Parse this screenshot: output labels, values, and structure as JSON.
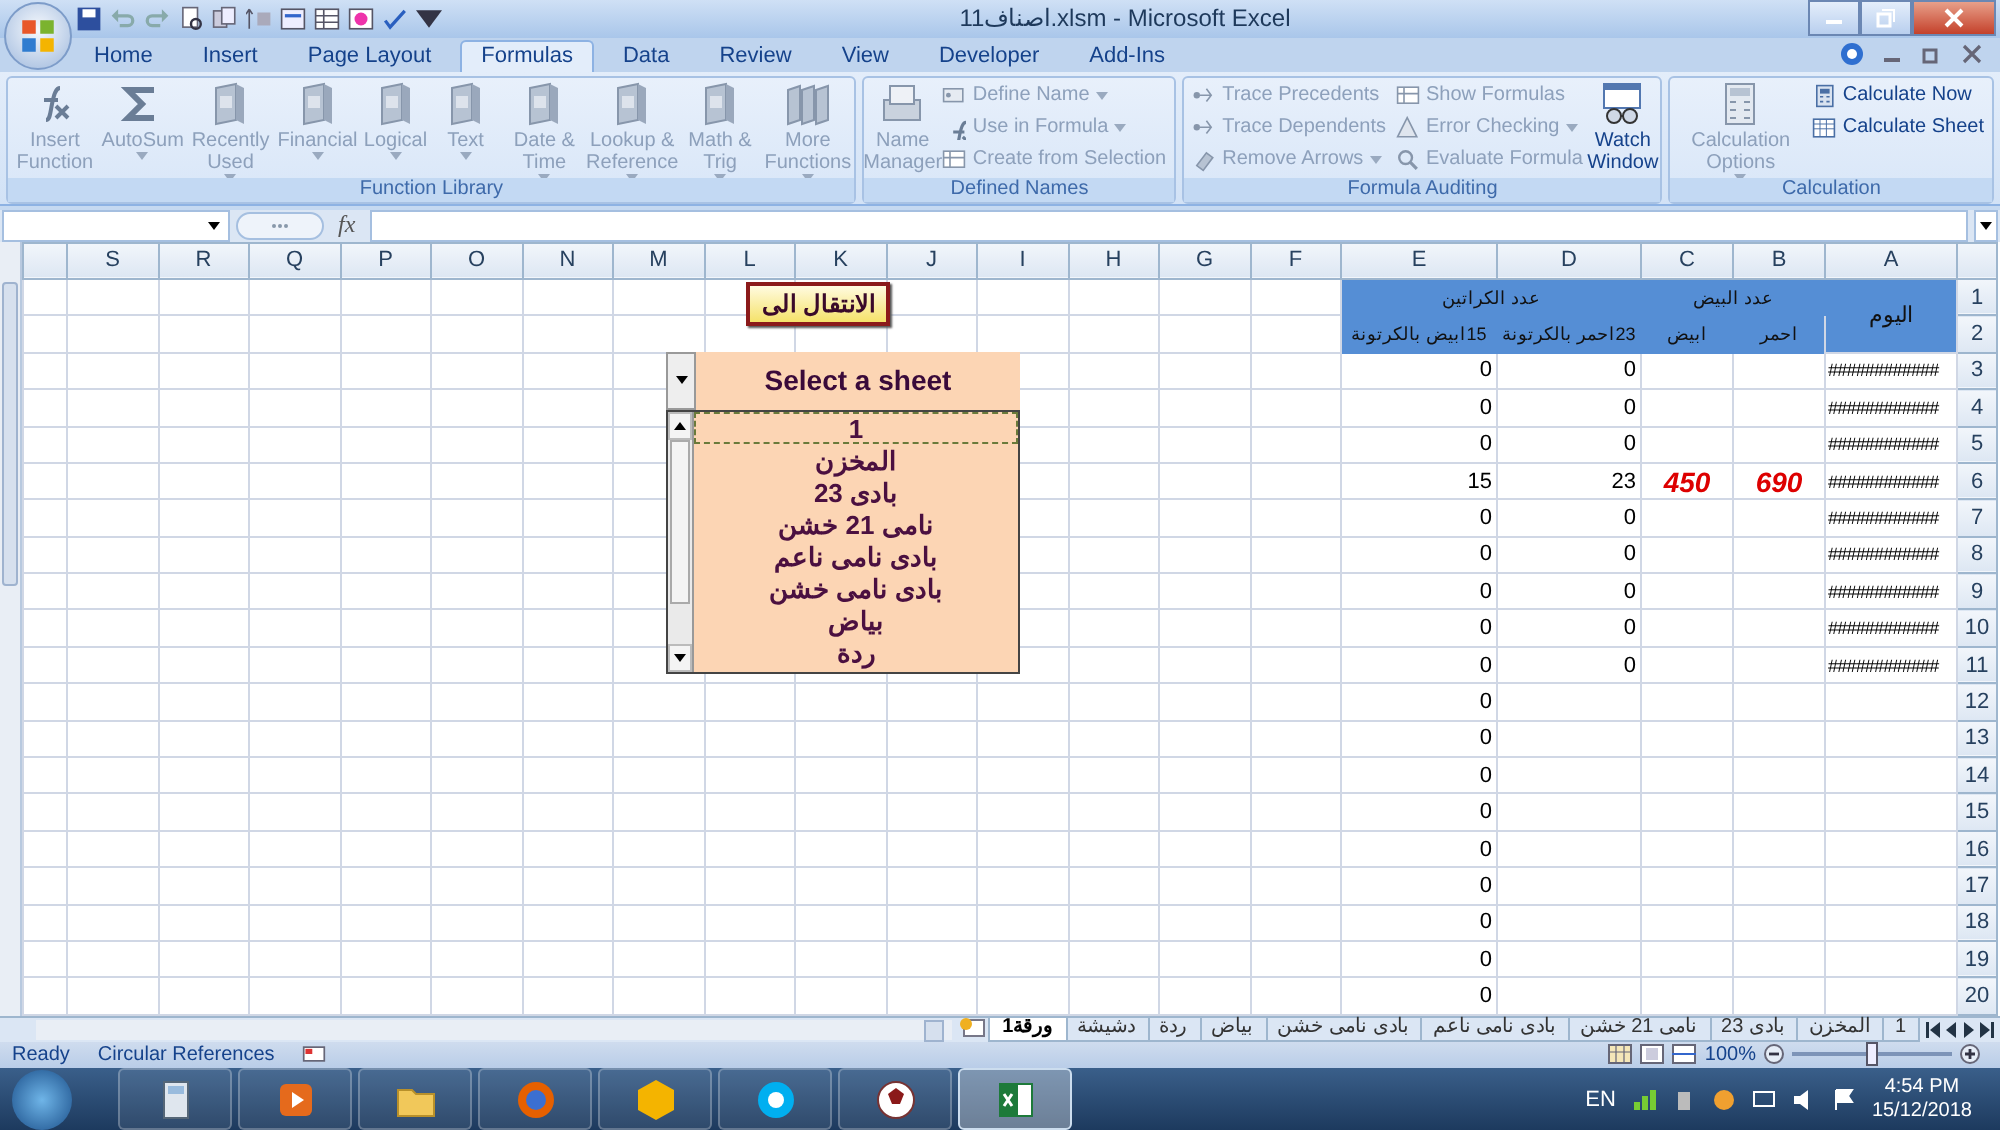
{
  "window": {
    "title": "اصناف11.xlsm - Microsoft Excel"
  },
  "tabs": [
    {
      "label": "Home",
      "selected": false
    },
    {
      "label": "Insert",
      "selected": false
    },
    {
      "label": "Page Layout",
      "selected": false
    },
    {
      "label": "Formulas",
      "selected": true
    },
    {
      "label": "Data",
      "selected": false
    },
    {
      "label": "Review",
      "selected": false
    },
    {
      "label": "View",
      "selected": false
    },
    {
      "label": "Developer",
      "selected": false
    },
    {
      "label": "Add-Ins",
      "selected": false
    }
  ],
  "ribbon": {
    "groups": [
      {
        "label": "Function Library",
        "items": [
          {
            "kind": "large",
            "label": "Insert Function",
            "disabled": true,
            "menu": false
          },
          {
            "kind": "large",
            "label": "AutoSum",
            "disabled": true,
            "menu": true
          },
          {
            "kind": "large",
            "label": "Recently Used",
            "disabled": true,
            "menu": true
          },
          {
            "kind": "large",
            "label": "Financial",
            "disabled": true,
            "menu": true
          },
          {
            "kind": "large",
            "label": "Logical",
            "disabled": true,
            "menu": true
          },
          {
            "kind": "large",
            "label": "Text",
            "disabled": true,
            "menu": true
          },
          {
            "kind": "large",
            "label": "Date & Time",
            "disabled": true,
            "menu": true
          },
          {
            "kind": "large",
            "label": "Lookup & Reference",
            "disabled": true,
            "menu": true
          },
          {
            "kind": "large",
            "label": "Math & Trig",
            "disabled": true,
            "menu": true
          },
          {
            "kind": "large",
            "label": "More Functions",
            "disabled": true,
            "menu": true
          }
        ]
      },
      {
        "label": "Defined Names",
        "items": [
          {
            "kind": "large",
            "label": "Name Manager",
            "disabled": true,
            "menu": false
          },
          {
            "kind": "small",
            "label": "Define Name",
            "disabled": true,
            "menu": true
          },
          {
            "kind": "small",
            "label": "Use in Formula",
            "disabled": true,
            "menu": true
          },
          {
            "kind": "small",
            "label": "Create from Selection",
            "disabled": true,
            "menu": false
          }
        ]
      },
      {
        "label": "Formula Auditing",
        "items": [
          {
            "kind": "small",
            "label": "Trace Precedents",
            "disabled": true,
            "menu": false
          },
          {
            "kind": "small",
            "label": "Trace Dependents",
            "disabled": true,
            "menu": false
          },
          {
            "kind": "small",
            "label": "Remove Arrows",
            "disabled": true,
            "menu": true
          },
          {
            "kind": "small",
            "label": "Show Formulas",
            "disabled": true,
            "menu": false
          },
          {
            "kind": "small",
            "label": "Error Checking",
            "disabled": true,
            "menu": true
          },
          {
            "kind": "small",
            "label": "Evaluate Formula",
            "disabled": true,
            "menu": false
          },
          {
            "kind": "large",
            "label": "Watch Window",
            "disabled": false,
            "menu": false
          }
        ]
      },
      {
        "label": "Calculation",
        "items": [
          {
            "kind": "large",
            "label": "Calculation Options",
            "disabled": true,
            "menu": true
          },
          {
            "kind": "small",
            "label": "Calculate Now",
            "disabled": false,
            "menu": false
          },
          {
            "kind": "small",
            "label": "Calculate Sheet",
            "disabled": false,
            "menu": false
          }
        ]
      }
    ]
  },
  "formula_bar": {
    "fx_label": "fx"
  },
  "sheet": {
    "columns": [
      "S",
      "R",
      "Q",
      "P",
      "O",
      "N",
      "M",
      "L",
      "K",
      "J",
      "I",
      "H",
      "G",
      "F",
      "E",
      "D",
      "C",
      "B",
      "A"
    ],
    "rows": [
      {
        "number": "1",
        "cells": {
          "E": {
            "text": "عدد الكراتين",
            "kind": "header_wide"
          },
          "C": {
            "text": "عدد البيض",
            "kind": "header_wide"
          },
          "A": {
            "text": "اليوم",
            "kind": "header_tall"
          }
        }
      },
      {
        "number": "2",
        "cells": {
          "B": {
            "text": "احمر",
            "kind": "header"
          },
          "C": {
            "text": "ابيض",
            "kind": "header"
          },
          "D": {
            "text": "23احمر بالكرتونة",
            "kind": "header"
          },
          "E": {
            "text": "15ابيض بالكرتونة",
            "kind": "header"
          }
        }
      },
      {
        "number": "3",
        "cells": {
          "A": {
            "text": "############",
            "kind": "text"
          },
          "D": {
            "text": "0",
            "kind": "number"
          },
          "E": {
            "text": "0",
            "kind": "number"
          }
        }
      },
      {
        "number": "4",
        "cells": {
          "A": {
            "text": "############",
            "kind": "text"
          },
          "D": {
            "text": "0",
            "kind": "number"
          },
          "E": {
            "text": "0",
            "kind": "number"
          }
        }
      },
      {
        "number": "5",
        "cells": {
          "A": {
            "text": "############",
            "kind": "text"
          },
          "D": {
            "text": "0",
            "kind": "number"
          },
          "E": {
            "text": "0",
            "kind": "number"
          }
        }
      },
      {
        "number": "6",
        "cells": {
          "A": {
            "text": "############",
            "kind": "text"
          },
          "B": {
            "text": "690",
            "kind": "highlight"
          },
          "C": {
            "text": "450",
            "kind": "highlight"
          },
          "D": {
            "text": "23",
            "kind": "number"
          },
          "E": {
            "text": "15",
            "kind": "number"
          }
        }
      },
      {
        "number": "7",
        "cells": {
          "A": {
            "text": "############",
            "kind": "text"
          },
          "D": {
            "text": "0",
            "kind": "number"
          },
          "E": {
            "text": "0",
            "kind": "number"
          }
        }
      },
      {
        "number": "8",
        "cells": {
          "A": {
            "text": "############",
            "kind": "text"
          },
          "D": {
            "text": "0",
            "kind": "number"
          },
          "E": {
            "text": "0",
            "kind": "number"
          }
        }
      },
      {
        "number": "9",
        "cells": {
          "A": {
            "text": "############",
            "kind": "text"
          },
          "D": {
            "text": "0",
            "kind": "number"
          },
          "E": {
            "text": "0",
            "kind": "number"
          }
        }
      },
      {
        "number": "10",
        "cells": {
          "A": {
            "text": "############",
            "kind": "text"
          },
          "D": {
            "text": "0",
            "kind": "number"
          },
          "E": {
            "text": "0",
            "kind": "number"
          }
        }
      },
      {
        "number": "11",
        "cells": {
          "A": {
            "text": "############",
            "kind": "text"
          },
          "D": {
            "text": "0",
            "kind": "number"
          },
          "E": {
            "text": "0",
            "kind": "number"
          }
        }
      },
      {
        "number": "12",
        "cells": {
          "E": {
            "text": "0",
            "kind": "number"
          }
        }
      },
      {
        "number": "13",
        "cells": {
          "E": {
            "text": "0",
            "kind": "number"
          }
        }
      },
      {
        "number": "14",
        "cells": {
          "E": {
            "text": "0",
            "kind": "number"
          }
        }
      },
      {
        "number": "15",
        "cells": {
          "E": {
            "text": "0",
            "kind": "number"
          }
        }
      },
      {
        "number": "16",
        "cells": {
          "E": {
            "text": "0",
            "kind": "number"
          }
        }
      },
      {
        "number": "17",
        "cells": {
          "E": {
            "text": "0",
            "kind": "number"
          }
        }
      },
      {
        "number": "18",
        "cells": {
          "E": {
            "text": "0",
            "kind": "number"
          }
        }
      },
      {
        "number": "19",
        "cells": {
          "E": {
            "text": "0",
            "kind": "number"
          }
        }
      },
      {
        "number": "20",
        "cells": {
          "E": {
            "text": "0",
            "kind": "number"
          }
        }
      }
    ]
  },
  "jump_button": {
    "label": "الانتقال الى"
  },
  "sheet_picker": {
    "value": "Select a sheet",
    "items": [
      {
        "label": "1",
        "selected": true
      },
      {
        "label": "المخزن",
        "selected": false
      },
      {
        "label": "بادى 23",
        "selected": false
      },
      {
        "label": "نامى 21 خشن",
        "selected": false
      },
      {
        "label": "بادى نامى  ناعم",
        "selected": false
      },
      {
        "label": "بادى نامى خشن",
        "selected": false
      },
      {
        "label": "بياض",
        "selected": false
      },
      {
        "label": "ردة",
        "selected": false
      }
    ]
  },
  "sheet_tabs": [
    {
      "label": "1",
      "selected": false
    },
    {
      "label": "المخزن",
      "selected": false
    },
    {
      "label": "بادى 23",
      "selected": false
    },
    {
      "label": "نامى 21 خشن",
      "selected": false
    },
    {
      "label": "بادى نامى  ناعم",
      "selected": false
    },
    {
      "label": "بادى نامى خشن",
      "selected": false
    },
    {
      "label": "بياض",
      "selected": false
    },
    {
      "label": "ردة",
      "selected": false
    },
    {
      "label": "دشيشة",
      "selected": false
    },
    {
      "label": "ورقة1",
      "selected": true
    }
  ],
  "status_bar": {
    "mode": "Ready",
    "message": "Circular References",
    "zoom": "100%",
    "zoom_slider": {
      "level": 0.5
    }
  },
  "taskbar": {
    "apps": [
      {
        "kind": "calculator",
        "selected": false
      },
      {
        "kind": "player",
        "selected": false
      },
      {
        "kind": "folder",
        "selected": false
      },
      {
        "kind": "browser",
        "selected": false
      },
      {
        "kind": "hexagon",
        "selected": false
      },
      {
        "kind": "chat",
        "selected": false
      },
      {
        "kind": "ball",
        "selected": false
      },
      {
        "kind": "spreadsheet",
        "selected": true
      }
    ],
    "language": "EN",
    "time": "4:54 PM",
    "date": "15/12/2018"
  }
}
